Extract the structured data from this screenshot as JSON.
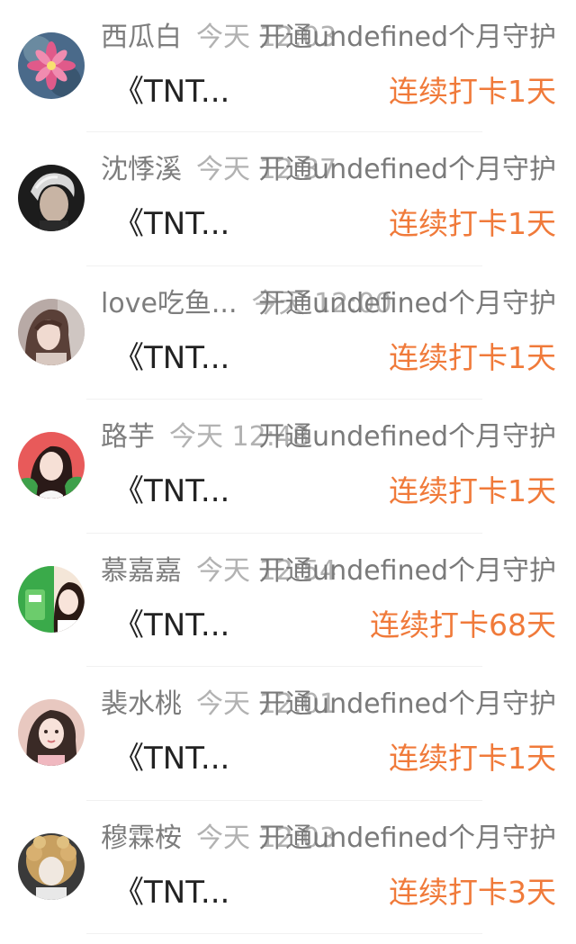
{
  "entries": [
    {
      "name": "西瓜白",
      "time": "今天 12:03",
      "action": "开通undefined个月守护",
      "title": "《TNT...",
      "streak": "连续打卡1天",
      "avatar_colors": [
        "#4a6a8a",
        "#e05a8a"
      ]
    },
    {
      "name": "沈悸溪",
      "time": "今天 12:37",
      "action": "开通undefined个月守护",
      "title": "《TNT...",
      "streak": "连续打卡1天",
      "avatar_colors": [
        "#1c1c1c",
        "#d8d8d8"
      ]
    },
    {
      "name": "love吃鱼...",
      "time": "今天 12:00",
      "action": "开通undefined个月守护",
      "title": "《TNT...",
      "streak": "连续打卡1天",
      "avatar_colors": [
        "#b8aaa6",
        "#5a4038"
      ]
    },
    {
      "name": "路芋",
      "time": "今天 12:48",
      "action": "开通undefined个月守护",
      "title": "《TNT...",
      "streak": "连续打卡1天",
      "avatar_colors": [
        "#e85a5a",
        "#3ea04a"
      ]
    },
    {
      "name": "慕嘉嘉",
      "time": "今天 12:54",
      "action": "开通undefined个月守护",
      "title": "《TNT...",
      "streak": "连续打卡68天",
      "avatar_colors": [
        "#3aaa4a",
        "#f4e6d8"
      ]
    },
    {
      "name": "裴水桃",
      "time": "今天 12:01",
      "action": "开通undefined个月守护",
      "title": "《TNT...",
      "streak": "连续打卡1天",
      "avatar_colors": [
        "#e8c8c0",
        "#3a2a26"
      ]
    },
    {
      "name": "穆霖桉",
      "time": "今天 12:03",
      "action": "开通undefined个月守护",
      "title": "《TNT...",
      "streak": "连续打卡3天",
      "avatar_colors": [
        "#c8a060",
        "#f0e8e0"
      ]
    }
  ],
  "colors": {
    "accent": "#f07a3a",
    "name_text": "#8c8c8c",
    "time_text": "#b2b2b2",
    "title_text": "#222222"
  }
}
